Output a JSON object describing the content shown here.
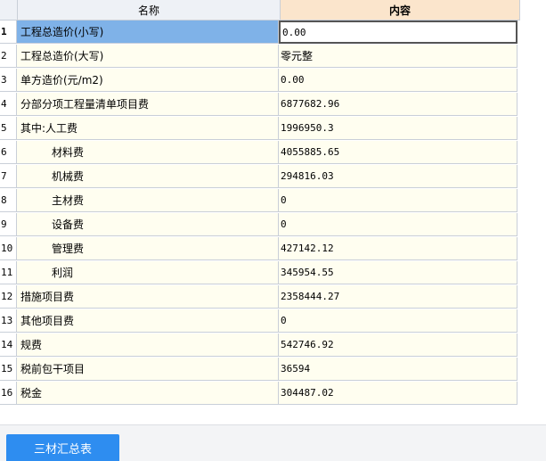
{
  "columns": {
    "name": "名称",
    "content": "内容"
  },
  "rows": [
    {
      "num": "1",
      "name": "工程总造价(小写)",
      "value": "0.00"
    },
    {
      "num": "2",
      "name": "工程总造价(大写)",
      "value": "零元整"
    },
    {
      "num": "3",
      "name": "单方造价(元/m2)",
      "value": "0.00"
    },
    {
      "num": "4",
      "name": "分部分项工程量清单项目费",
      "value": "6877682.96"
    },
    {
      "num": "5",
      "name": "其中:人工费",
      "value": "1996950.3"
    },
    {
      "num": "6",
      "name": "材料费",
      "value": "4055885.65"
    },
    {
      "num": "7",
      "name": "机械费",
      "value": "294816.03"
    },
    {
      "num": "8",
      "name": "主材费",
      "value": "0"
    },
    {
      "num": "9",
      "name": "设备费",
      "value": "0"
    },
    {
      "num": "10",
      "name": "管理费",
      "value": "427142.12"
    },
    {
      "num": "11",
      "name": "利润",
      "value": "345954.55"
    },
    {
      "num": "12",
      "name": "措施项目费",
      "value": "2358444.27"
    },
    {
      "num": "13",
      "name": "其他项目费",
      "value": "0"
    },
    {
      "num": "14",
      "name": "规费",
      "value": "542746.92"
    },
    {
      "num": "15",
      "name": "税前包干项目",
      "value": "36594"
    },
    {
      "num": "16",
      "name": "税金",
      "value": "304487.02"
    }
  ],
  "bottom_tab": {
    "label": "三材汇总表"
  },
  "colors": {
    "header_bg": "#eef1f6",
    "content_header_bg": "#fbe5cc",
    "cell_bg": "#fffef0",
    "selected_bg": "#7fb2e8",
    "tab_bg": "#2e8df0"
  }
}
